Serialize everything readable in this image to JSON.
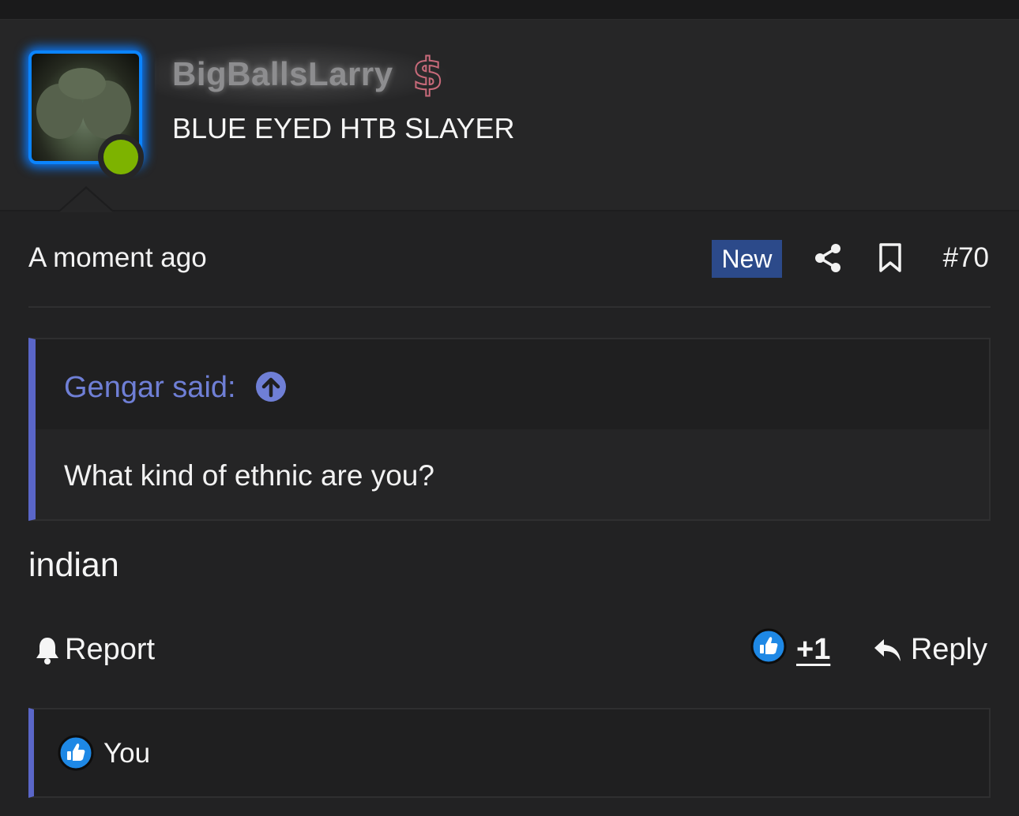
{
  "user": {
    "username": "BigBallsLarry",
    "title": "BLUE EYED HTB SLAYER",
    "status": "online",
    "badge_icon": "dollar-icon",
    "accent": "#0a84ff"
  },
  "post": {
    "timestamp": "A moment ago",
    "new_label": "New",
    "number": "#70",
    "body": "indian"
  },
  "quote": {
    "author": "Gengar said:",
    "text": "What kind of ethnic are you?"
  },
  "actions": {
    "report": "Report",
    "like_count": "+1",
    "reply": "Reply"
  },
  "reactions": {
    "who": "You"
  },
  "colors": {
    "background": "#222223",
    "quote_accent": "#5a66c8",
    "new_badge": "#2c4a8a",
    "online": "#7db300",
    "like_blue": "#1e88e5"
  }
}
